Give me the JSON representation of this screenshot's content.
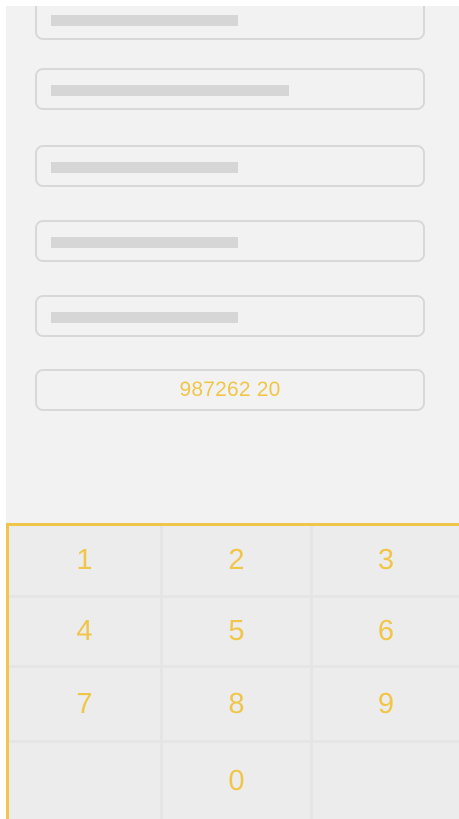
{
  "form": {
    "fields": [
      {
        "name": "form-field-1",
        "placeholder_bar_ratio": 0.48
      },
      {
        "name": "form-field-2",
        "placeholder_bar_ratio": 0.61
      },
      {
        "name": "form-field-3",
        "placeholder_bar_ratio": 0.48
      },
      {
        "name": "form-field-4",
        "placeholder_bar_ratio": 0.48
      },
      {
        "name": "form-field-5",
        "placeholder_bar_ratio": 0.48
      }
    ],
    "entered_value": "987262 20"
  },
  "keypad": {
    "keys": [
      {
        "label": "1"
      },
      {
        "label": "2"
      },
      {
        "label": "3"
      },
      {
        "label": "4"
      },
      {
        "label": "5"
      },
      {
        "label": "6"
      },
      {
        "label": "7"
      },
      {
        "label": "8"
      },
      {
        "label": "9"
      },
      {
        "label": ""
      },
      {
        "label": "0"
      },
      {
        "label": ""
      }
    ]
  },
  "colors": {
    "accent": "#f0c64a",
    "background": "#f2f2f2",
    "field_border": "#d8d8d8",
    "placeholder_bar": "#d6d6d6",
    "key_background": "#ececec"
  }
}
